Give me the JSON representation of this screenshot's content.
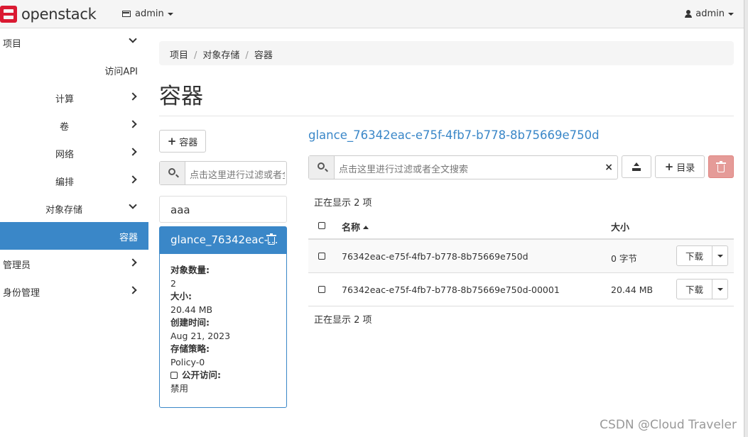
{
  "navbar": {
    "logo_text": "openstack",
    "project_label": "admin",
    "user_label": "admin"
  },
  "sidebar": {
    "items": [
      {
        "label": "项目"
      },
      {
        "label": "访问API"
      },
      {
        "label": "计算"
      },
      {
        "label": "卷"
      },
      {
        "label": "网络"
      },
      {
        "label": "编排"
      },
      {
        "label": "对象存储"
      },
      {
        "label": "容器"
      },
      {
        "label": "管理员"
      },
      {
        "label": "身份管理"
      }
    ]
  },
  "breadcrumb": [
    "项目",
    "/",
    "对象存储",
    "/",
    "容器"
  ],
  "page_title": "容器",
  "left_panel": {
    "add_container_label": "容器",
    "search_placeholder": "点击这里进行过滤或者全文搜索",
    "containers": [
      {
        "name": "aaa"
      },
      {
        "name": "glance_76342eac-..."
      }
    ],
    "details": {
      "object_count_label": "对象数量:",
      "object_count": "2",
      "size_label": "大小:",
      "size": "20.44 MB",
      "created_label": "创建时间:",
      "created": "Aug 21, 2023",
      "policy_label": "存储策略:",
      "policy": "Policy-0",
      "public_label": "公开访问:",
      "public": "禁用"
    }
  },
  "right_panel": {
    "container_title": "glance_76342eac-e75f-4fb7-b778-8b75669e750d",
    "search_placeholder": "点击这里进行过滤或者全文搜索",
    "clear_label": "×",
    "folder_button_label": "目录",
    "showing_top": "正在显示 2 项",
    "showing_bottom": "正在显示 2 项",
    "columns": {
      "name": "名称",
      "size": "大小"
    },
    "rows": [
      {
        "name": "76342eac-e75f-4fb7-b778-8b75669e750d",
        "size": "0 字节",
        "action": "下载"
      },
      {
        "name": "76342eac-e75f-4fb7-b778-8b75669e750d-00001",
        "size": "20.44 MB",
        "action": "下载"
      }
    ]
  },
  "watermark": "CSDN @Cloud Traveler",
  "colors": {
    "accent": "#3a87c8",
    "brand": "#da1a32",
    "danger": "#e59b98"
  }
}
